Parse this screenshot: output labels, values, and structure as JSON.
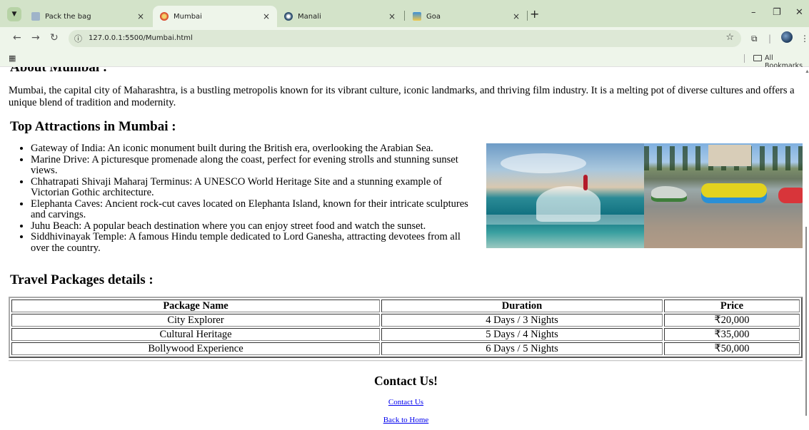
{
  "browser": {
    "tabs": [
      {
        "title": "Pack the bag",
        "active": false
      },
      {
        "title": "Mumbai",
        "active": true
      },
      {
        "title": "Manali",
        "active": false
      },
      {
        "title": "Goa",
        "active": false
      }
    ],
    "close_glyph": "×",
    "new_tab_glyph": "+",
    "url": "127.0.0.1:5500/Mumbai.html",
    "bookmarks_label": "All Bookmarks"
  },
  "page": {
    "cut_heading": "About Mumbai :",
    "intro": "Mumbai, the capital city of Maharashtra, is a bustling metropolis known for its vibrant culture, iconic landmarks, and thriving film industry. It is a melting pot of diverse cultures and offers a unique blend of tradition and modernity.",
    "attractions_heading": "Top Attractions in Mumbai :",
    "attractions": [
      "Gateway of India: An iconic monument built during the British era, overlooking the Arabian Sea.",
      "Marine Drive: A picturesque promenade along the coast, perfect for evening strolls and stunning sunset views.",
      "Chhatrapati Shivaji Maharaj Terminus: A UNESCO World Heritage Site and a stunning example of Victorian Gothic architecture.",
      "Elephanta Caves: Ancient rock-cut caves located on Elephanta Island, known for their intricate sculptures and carvings.",
      "Juhu Beach: A popular beach destination where you can enjoy street food and watch the sunset.",
      "Siddhivinayak Temple: A famous Hindu temple dedicated to Lord Ganesha, attracting devotees from all over the country."
    ],
    "packages_heading": "Travel Packages details :",
    "packages_table": {
      "headers": [
        "Package Name",
        "Duration",
        "Price"
      ],
      "rows": [
        [
          "City Explorer",
          "4 Days / 3 Nights",
          "₹20,000"
        ],
        [
          "Cultural Heritage",
          "5 Days / 4 Nights",
          "₹35,000"
        ],
        [
          "Bollywood Experience",
          "6 Days / 5 Nights",
          "₹50,000"
        ]
      ]
    },
    "contact_heading": "Contact Us!",
    "contact_link": "Contact Us",
    "home_link": "Back to Home"
  },
  "colors": {
    "chrome_bg": "#d3e3c9",
    "toolbar_bg": "#eef5ea",
    "link": "#0000ee"
  }
}
